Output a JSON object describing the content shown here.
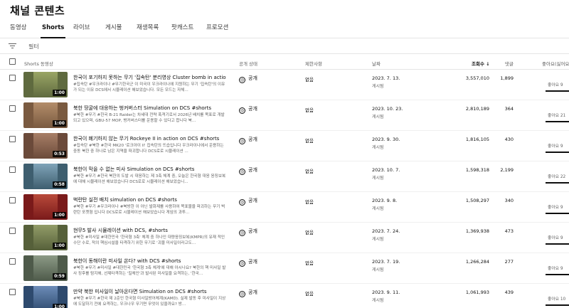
{
  "page": {
    "title": "채널 콘텐츠"
  },
  "tabs": [
    {
      "label": "동영상"
    },
    {
      "label": "Shorts"
    },
    {
      "label": "라이브"
    },
    {
      "label": "게시물"
    },
    {
      "label": "재생목록"
    },
    {
      "label": "팟캐스트"
    },
    {
      "label": "프로모션"
    }
  ],
  "filter": {
    "placeholder": "필터"
  },
  "header": {
    "video": "Shorts 동영상",
    "visibility": "공개 상태",
    "restrictions": "제한사항",
    "date": "날짜",
    "views": "조회수",
    "sort_arrow": "↓",
    "comments": "댓글",
    "likes": "좋아요(싫어요"
  },
  "rows": [
    {
      "title": "한국이 포기하지 못하는 무기 '집속탄' 분리영상 Cluster bomb in action, s...",
      "desc": "#집속탄 #우크라이나 #무기한국군 이 미국이 우크라이나에 지원하는 무기 '집속탄'의 이유가 되는 이유 DCS에서 시뮬레이션 해보았습니다. 모든 모드는 자체...",
      "duration": "1:00",
      "visibility": "공개",
      "restriction": "없음",
      "date": "2023. 7. 13.",
      "date_label": "게시됨",
      "views": "3,557,010",
      "comments": "1,899",
      "likes": "좋아요 9",
      "like_ratio": 0.95,
      "colors": [
        "#5f6a3f",
        "#9aa565"
      ]
    },
    {
      "title": "북한 땅굴에 대응하는 벙커버스터 Simulation on DCS #shorts",
      "desc": "#북한 #무기 #한국 B-21 Raider는 차세대 전략 폭격기로서 2026년 배치를 목표로 개발되고 있으며, GBU-57 MOP, 벙커버스터를 운용할 수 있다고 합니다 북...",
      "duration": "1:00",
      "visibility": "공개",
      "restriction": "없음",
      "date": "2023. 10. 23.",
      "date_label": "게시됨",
      "views": "2,810,189",
      "comments": "364",
      "likes": "좋아요 21",
      "like_ratio": 0.97,
      "colors": [
        "#7a5a40",
        "#b38d6a"
      ]
    },
    {
      "title": "한국이 폐기하지 않는 무기 Rockeye II in action on DCS #shorts",
      "desc": "#집속탄 #북한 #한국 MK20 '로크아이 II' 집속탄의 뜨습입니다 우크라이나에서 운용하는 중동 북한 중 하나로 남은 지역을 파괴합니다 DCS로로 시뮬레이션 ...",
      "duration": "0:53",
      "visibility": "공개",
      "restriction": "없음",
      "date": "2023. 9. 30.",
      "date_label": "게시됨",
      "views": "1,816,105",
      "comments": "430",
      "likes": "좋아요 9",
      "like_ratio": 0.94,
      "colors": [
        "#6b4a3a",
        "#a77e66"
      ]
    },
    {
      "title": "북한이 막을 수 없는 미사 Simulation on DCS #shorts",
      "desc": "#북한 #무기 #한국 북한의 도발 시 대응하는 제 3축 체계 중, 오늘은 한국형 대응 응징보복에 대해 시뮬레이션 해보았습니다 DCS로로 시뮬레이션 해보았습니...",
      "duration": "0:58",
      "visibility": "공개",
      "restriction": "없음",
      "date": "2023. 10. 7.",
      "date_label": "게시됨",
      "views": "1,598,318",
      "comments": "2,199",
      "likes": "좋아요 22",
      "like_ratio": 0.93,
      "colors": [
        "#3e5e6f",
        "#7fa3b8"
      ]
    },
    {
      "title": "벅란탄 실전 배치 simulation on DCS #shorts",
      "desc": "#북한 #무기 #우크라이나 #북방한 이 아닌 발화제를 사용하여 목표물을 파괴하는 무기 벅란탄 포켓형 입니다 DCS로로 시뮬레이션 해보았습니다 게임의 과투...",
      "duration": "1:00",
      "visibility": "공개",
      "restriction": "없음",
      "date": "2023. 9. 8.",
      "date_label": "게시됨",
      "views": "1,508,297",
      "comments": "340",
      "likes": "좋아요 9",
      "like_ratio": 0.92,
      "colors": [
        "#7a1a1a",
        "#b84a3a"
      ]
    },
    {
      "title": "현무5 발사 시뮬레이션 with DCS, #shorts",
      "desc": "#북한 #미사일 #대한민국 '한국형 3축' 체계 중 하나인 대량응징보복(KMPR)의 유재 적인 수단 수로, 적의 핵심시설을 타격하기 위한 무기로 '괴물 미사일이라고도...",
      "duration": "1:00",
      "visibility": "공개",
      "restriction": "없음",
      "date": "2023. 7. 24.",
      "date_label": "게시됨",
      "views": "1,369,938",
      "comments": "473",
      "likes": "좋아요 9",
      "like_ratio": 0.96,
      "colors": [
        "#56603a",
        "#929c68"
      ]
    },
    {
      "title": "북한이 동해이란 미사일 쏜다? with DCS #shorts",
      "desc": "#북한 #무기 #미사일 #대한민국 '한국형 3축 체계'에 대해 아시나요? 북한의 핵 미사일 발사 징후를 탐지해, 선제타격하는 '킬체인'과 발사된 미사일을 요격하는, '한국...",
      "duration": "0:59",
      "visibility": "공개",
      "restriction": "없음",
      "date": "2023. 7. 19.",
      "date_label": "게시됨",
      "views": "1,266,284",
      "comments": "277",
      "likes": "좋아요 9",
      "like_ratio": 0.95,
      "colors": [
        "#4e5a4a",
        "#8c9a86"
      ]
    },
    {
      "title": "만약 북한 미사일이 날아온다면 Simulation on DCS #shorts",
      "desc": "#북한 #무기 #한국 제 2준인 한국형 미사일방어체계(KAMD). 실제 발동 후 미사일이 지상에 도달하기 전에 요격하는, 우크나우 무기면 무엇이 있을까요? 방...",
      "duration": "1:00",
      "visibility": "공개",
      "restriction": "없음",
      "date": "2023. 9. 11.",
      "date_label": "게시됨",
      "views": "1,061,993",
      "comments": "439",
      "likes": "좋아요 10",
      "like_ratio": 0.96,
      "colors": [
        "#2e4a6e",
        "#6c8cb8"
      ]
    }
  ],
  "colors": {
    "text": "#0f0f0f",
    "muted": "#606060",
    "divider": "#e5e5e5"
  },
  "icons": {
    "filter": "filter-icon",
    "visibility": "globe-icon",
    "sort": "arrow-down-icon"
  }
}
